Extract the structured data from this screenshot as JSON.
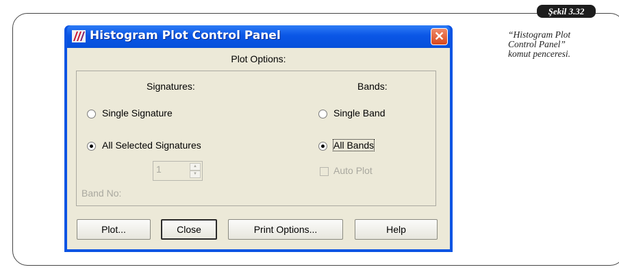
{
  "figure": {
    "label": "Şekil 3.32",
    "caption_lines": [
      "“Histogram Plot",
      "Control Panel”",
      "komut penceresi."
    ]
  },
  "window": {
    "title": "Histogram Plot Control Panel",
    "close_glyph": "✕",
    "app_icon": "histogram-app-icon"
  },
  "panel": {
    "header": "Plot Options:",
    "signatures": {
      "heading": "Signatures:",
      "options": [
        "Single Signature",
        "All Selected Signatures"
      ],
      "selected": "All Selected Signatures"
    },
    "bands": {
      "heading": "Bands:",
      "options": [
        "Single Band",
        "All Bands"
      ],
      "selected": "All Bands"
    },
    "band_no": {
      "label": "Band No:",
      "value": "1",
      "enabled": false
    },
    "auto_plot": {
      "label": "Auto Plot",
      "checked": false,
      "enabled": false
    }
  },
  "buttons": {
    "plot": "Plot...",
    "close": "Close",
    "print_options": "Print Options...",
    "help": "Help"
  },
  "colors": {
    "title_bar": "#0b54e3",
    "client_bg": "#ece9d8",
    "close_button": "#d9481c"
  }
}
